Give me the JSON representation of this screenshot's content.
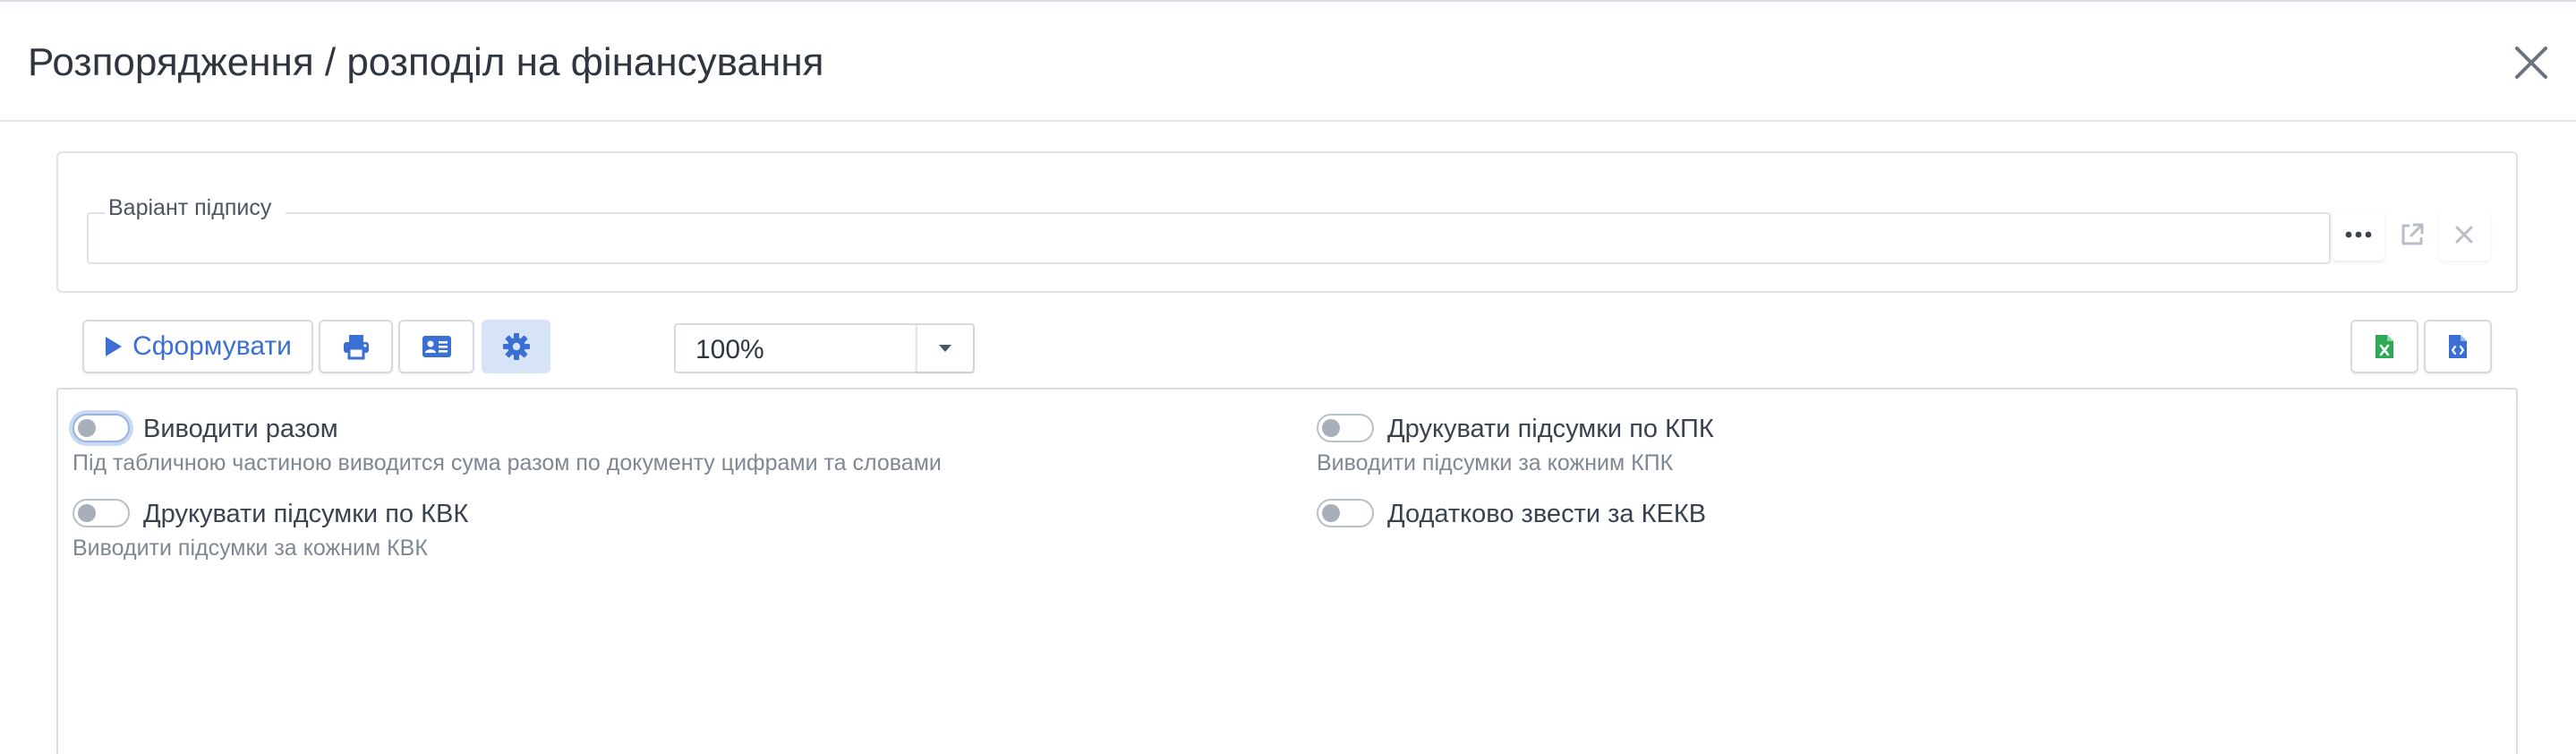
{
  "header": {
    "title": "Розпорядження / розподіл на фінансування",
    "close_icon": "close-icon"
  },
  "signature": {
    "label": "Варіант підпису",
    "value": "",
    "buttons": {
      "more_icon": "ellipsis-icon",
      "open_icon": "external-link-icon",
      "clear_icon": "close-icon"
    }
  },
  "toolbar": {
    "generate_label": "Сформувати",
    "generate_icon": "play-icon",
    "print_icon": "printer-icon",
    "card_icon": "id-card-icon",
    "settings_icon": "gear-icon",
    "zoom_value": "100%",
    "zoom_arrow_icon": "caret-down-icon",
    "export_excel_icon": "excel-file-icon",
    "export_code_icon": "code-file-icon"
  },
  "options": [
    {
      "label": "Виводити разом",
      "description": "Під табличною частиною виводится сума разом по документу цифрами та словами",
      "checked": false
    },
    {
      "label": "Друкувати підсумки по КПК",
      "description": "Виводити підсумки за кожним КПК",
      "checked": false
    },
    {
      "label": "Друкувати підсумки по КВК",
      "description": "Виводити підсумки за кожним КВК",
      "checked": false
    },
    {
      "label": "Додатково звести за КЕКВ",
      "description": "",
      "checked": false
    }
  ],
  "colors": {
    "accent": "#3b6fd4",
    "excel": "#2eaa57",
    "active_button_bg": "#d7e4f7"
  }
}
